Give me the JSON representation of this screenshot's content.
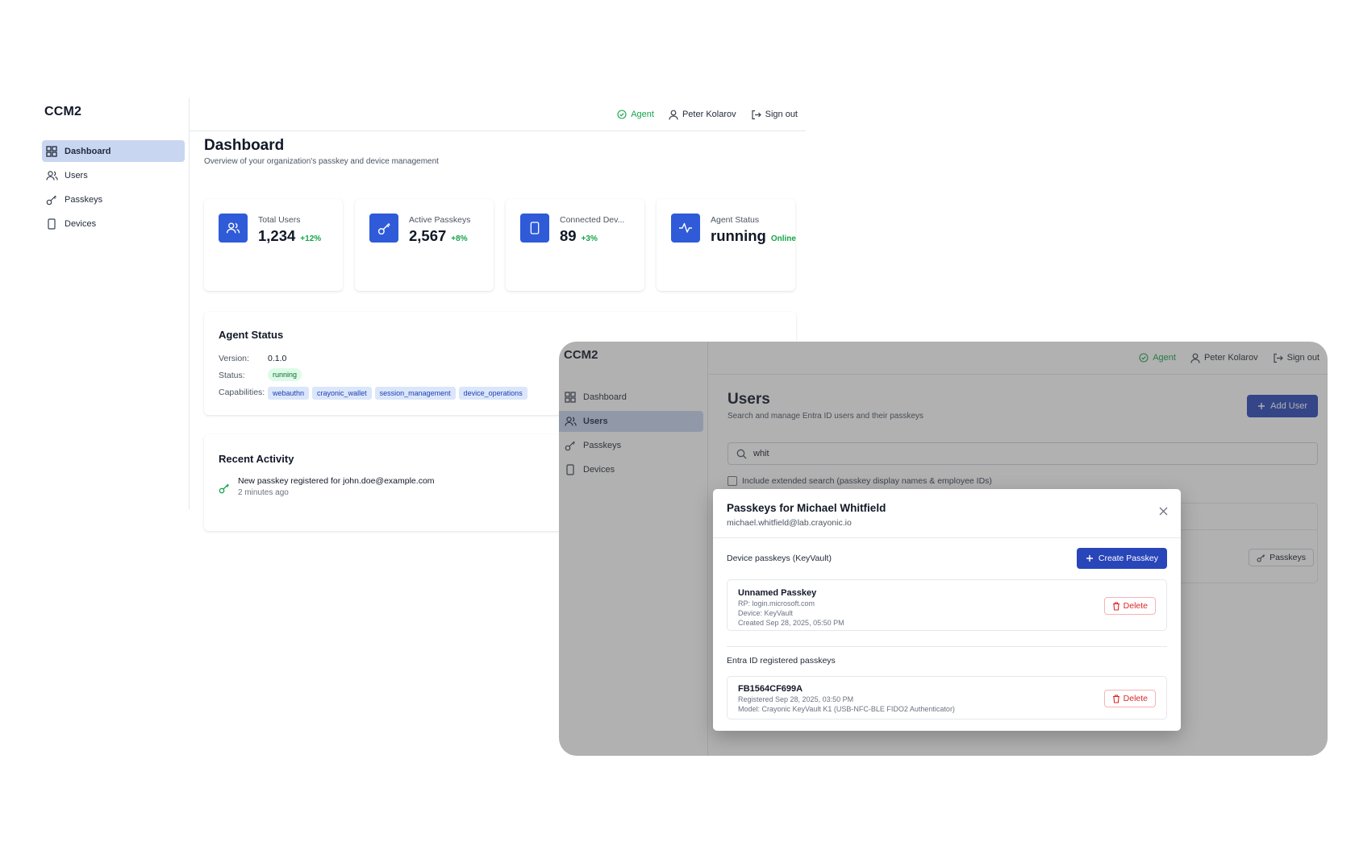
{
  "dashboard_window": {
    "brand": "CCM2",
    "nav": [
      {
        "label": "Dashboard",
        "icon": "grid-icon",
        "active": true
      },
      {
        "label": "Users",
        "icon": "users-icon",
        "active": false
      },
      {
        "label": "Passkeys",
        "icon": "key-icon",
        "active": false
      },
      {
        "label": "Devices",
        "icon": "device-icon",
        "active": false
      }
    ],
    "topbar": {
      "agent": "Agent",
      "user": "Peter Kolarov",
      "signout": "Sign out"
    },
    "title": "Dashboard",
    "subtitle": "Overview of your organization's passkey and device management",
    "stats": [
      {
        "label": "Total Users",
        "value": "1,234",
        "delta": "+12%",
        "icon": "users-icon"
      },
      {
        "label": "Active Passkeys",
        "value": "2,567",
        "delta": "+8%",
        "icon": "key-icon"
      },
      {
        "label": "Connected Dev...",
        "value": "89",
        "delta": "+3%",
        "icon": "device-icon"
      },
      {
        "label": "Agent Status",
        "value": "running",
        "delta": "Online",
        "icon": "activity-icon"
      }
    ],
    "agent_status": {
      "title": "Agent Status",
      "version_label": "Version:",
      "version": "0.1.0",
      "status_label": "Status:",
      "status": "running",
      "capabilities_label": "Capabilities:",
      "capabilities": [
        "webauthn",
        "crayonic_wallet",
        "session_management",
        "device_operations"
      ]
    },
    "recent_activity": {
      "title": "Recent Activity",
      "items": [
        {
          "text": "New passkey registered for john.doe@example.com",
          "time": "2 minutes ago",
          "icon": "key-icon"
        }
      ]
    },
    "colors": {
      "accent": "#2f5bd8",
      "success": "#16a34a",
      "nav_active": "#c9d6f2"
    }
  },
  "users_window": {
    "brand": "CCM2",
    "nav": [
      {
        "label": "Dashboard",
        "icon": "grid-icon",
        "active": false
      },
      {
        "label": "Users",
        "icon": "users-icon",
        "active": true
      },
      {
        "label": "Passkeys",
        "icon": "key-icon",
        "active": false
      },
      {
        "label": "Devices",
        "icon": "device-icon",
        "active": false
      }
    ],
    "topbar": {
      "agent": "Agent",
      "user": "Peter Kolarov",
      "signout": "Sign out"
    },
    "title": "Users",
    "subtitle": "Search and manage Entra ID users and their passkeys",
    "add_user": "Add User",
    "search_value": "whit",
    "extended_search_label": "Include extended search (passkey display names & employee IDs)",
    "passkeys_button": "Passkeys",
    "modal": {
      "title": "Passkeys for Michael Whitfield",
      "email": "michael.whitfield@lab.crayonic.io",
      "device_section": "Device passkeys (KeyVault)",
      "create_button": "Create Passkey",
      "device_passkeys": [
        {
          "name": "Unnamed Passkey",
          "rp": "RP: login.microsoft.com",
          "device": "Device: KeyVault",
          "created": "Created Sep 28, 2025, 05:50 PM",
          "delete": "Delete"
        }
      ],
      "entra_section": "Entra ID registered passkeys",
      "entra_passkeys": [
        {
          "name": "FB1564CF699A",
          "registered": "Registered Sep 28, 2025, 03:50 PM",
          "model": "Model: Crayonic KeyVault K1 (USB-NFC-BLE FIDO2 Authenticator)",
          "delete": "Delete"
        }
      ]
    },
    "colors": {
      "primary_button": "#2845b9",
      "danger": "#dc2626",
      "overlay": "rgba(70,70,70,0.42)"
    }
  }
}
